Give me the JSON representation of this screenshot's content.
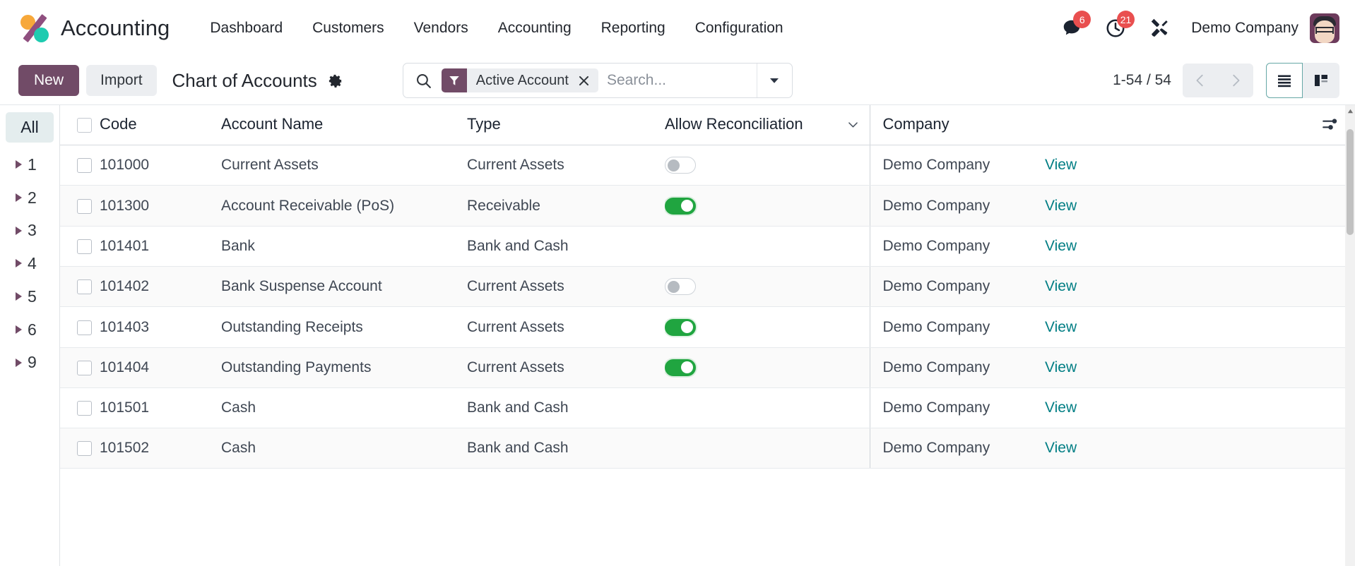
{
  "navbar": {
    "brand": "Accounting",
    "menu": [
      {
        "label": "Dashboard"
      },
      {
        "label": "Customers"
      },
      {
        "label": "Vendors"
      },
      {
        "label": "Accounting"
      },
      {
        "label": "Reporting"
      },
      {
        "label": "Configuration"
      }
    ],
    "messages_badge": "6",
    "activities_badge": "21",
    "company": "Demo Company"
  },
  "control_panel": {
    "new_label": "New",
    "import_label": "Import",
    "breadcrumb_title": "Chart of Accounts",
    "search": {
      "facet_label": "Active Account",
      "placeholder": "Search...",
      "value": ""
    },
    "pager": "1-54 / 54"
  },
  "sidebar": {
    "all_label": "All",
    "items": [
      {
        "label": "1"
      },
      {
        "label": "2"
      },
      {
        "label": "3"
      },
      {
        "label": "4"
      },
      {
        "label": "5"
      },
      {
        "label": "6"
      },
      {
        "label": "9"
      }
    ]
  },
  "table": {
    "columns": {
      "code": "Code",
      "name": "Account Name",
      "type": "Type",
      "reconciliation": "Allow Reconciliation",
      "company": "Company"
    },
    "view_link_label": "View",
    "rows": [
      {
        "code": "101000",
        "name": "Current Assets",
        "type": "Current Assets",
        "recon": "off",
        "company": "Demo Company",
        "view": "View"
      },
      {
        "code": "101300",
        "name": "Account Receivable (PoS)",
        "type": "Receivable",
        "recon": "on",
        "company": "Demo Company",
        "view": "View"
      },
      {
        "code": "101401",
        "name": "Bank",
        "type": "Bank and Cash",
        "recon": "none",
        "company": "Demo Company",
        "view": "View"
      },
      {
        "code": "101402",
        "name": "Bank Suspense Account",
        "type": "Current Assets",
        "recon": "off",
        "company": "Demo Company",
        "view": "View"
      },
      {
        "code": "101403",
        "name": "Outstanding Receipts",
        "type": "Current Assets",
        "recon": "on",
        "company": "Demo Company",
        "view": "View"
      },
      {
        "code": "101404",
        "name": "Outstanding Payments",
        "type": "Current Assets",
        "recon": "on",
        "company": "Demo Company",
        "view": "View"
      },
      {
        "code": "101501",
        "name": "Cash",
        "type": "Bank and Cash",
        "recon": "none",
        "company": "Demo Company",
        "view": "View"
      },
      {
        "code": "101502",
        "name": "Cash",
        "type": "Bank and Cash",
        "recon": "none",
        "company": "Demo Company",
        "view": "View"
      }
    ]
  },
  "colors": {
    "brand_purple": "#714b67",
    "toggle_on_green": "#20a540",
    "link_teal": "#017e84",
    "badge_red": "#e94f4f"
  }
}
